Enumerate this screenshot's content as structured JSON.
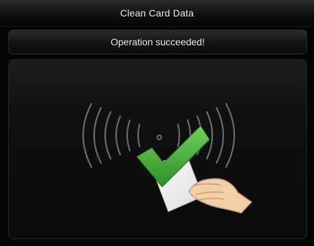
{
  "window": {
    "title": "Clean Card Data"
  },
  "status": {
    "message": "Operation succeeded!"
  },
  "illustration": {
    "icons": [
      "rfid-waves-icon",
      "checkmark-icon",
      "card-icon",
      "hand-icon"
    ],
    "colors": {
      "checkmark": "#3aa630",
      "waves": "#6c6c6c",
      "card": "#f4f4f4",
      "hand": "#f2cfa8"
    }
  }
}
